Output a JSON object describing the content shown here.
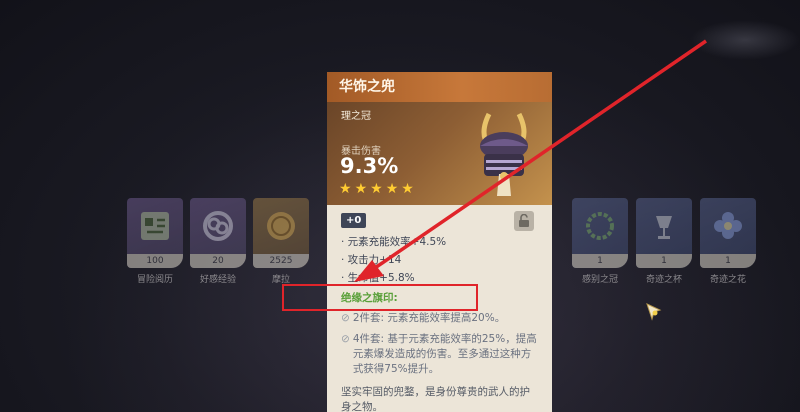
{
  "inventory": [
    {
      "count": "100",
      "name": "冒险阅历",
      "icon": "adventure-exp-icon"
    },
    {
      "count": "20",
      "name": "好感经验",
      "icon": "friendship-exp-icon"
    },
    {
      "count": "2525",
      "name": "摩拉",
      "icon": "mora-coin-icon"
    },
    {
      "count": "1",
      "name": "感别之冠",
      "icon": "wreath-circlet-icon"
    },
    {
      "count": "1",
      "name": "奇迹之杯",
      "icon": "crystal-goblet-icon"
    },
    {
      "count": "1",
      "name": "奇迹之花",
      "icon": "blue-flower-icon"
    }
  ],
  "artifact": {
    "name": "华饰之兜",
    "piece_type": "理之冠",
    "main_stat_label": "暴击伤害",
    "main_stat_value": "9.3%",
    "rarity": 5,
    "level": "+0",
    "substats": [
      "· 元素充能效率+4.5%",
      "· 攻击力+14",
      "· 生命值+5.8%"
    ],
    "set_name": "绝缘之旗印:",
    "set_bonuses": [
      "2件套: 元素充能效率提高20%。",
      "4件套: 基于元素充能效率的25%，提高元素爆发造成的伤害。至多通过这种方式获得75%提升。"
    ],
    "description": "坚实牢固的兜鍪，是身份尊贵的武人的护身之物。",
    "icons": {
      "helmet": "kabuto-helmet-icon",
      "lock": "unlock-icon",
      "set_bullet": "circle-slash-icon"
    }
  },
  "colors": {
    "header": "#b86d33",
    "card_bg": "#ece5d8",
    "star": "#ffcc32",
    "set_name": "#5aa03a",
    "annotation": "#e0242a"
  }
}
